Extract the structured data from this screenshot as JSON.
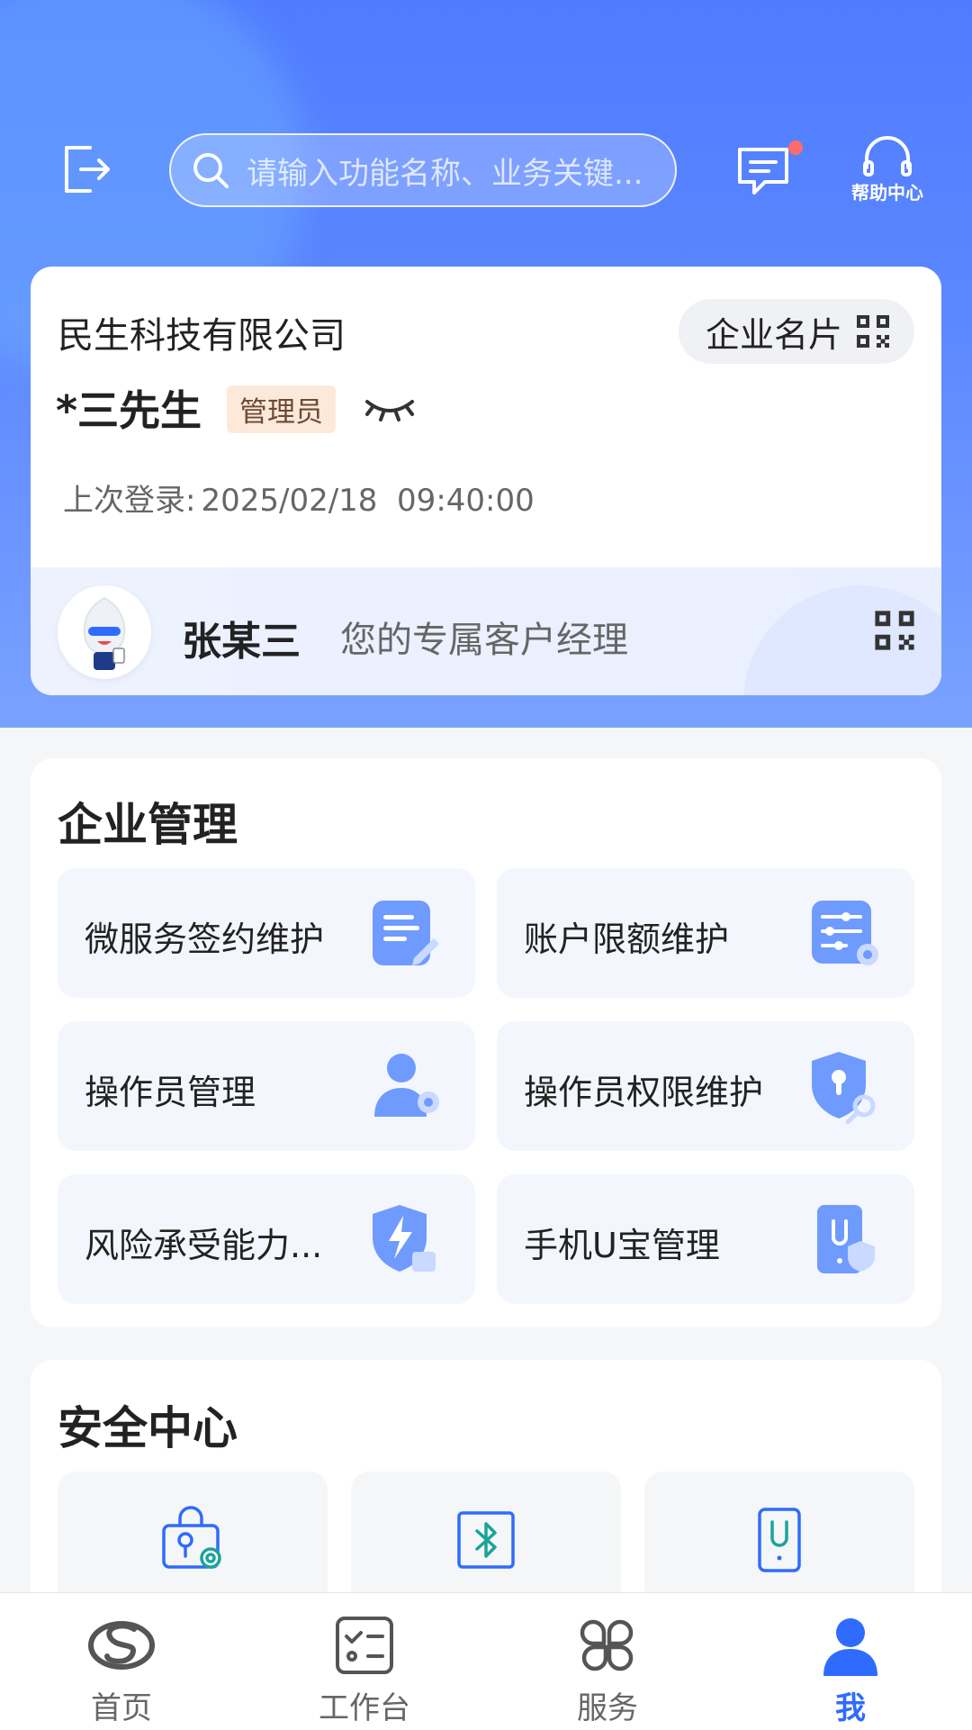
{
  "header": {
    "search_placeholder": "请输入功能名称、业务关键...",
    "help_label": "帮助中心",
    "icons": [
      "logout-icon",
      "search-icon",
      "message-icon",
      "headset-icon"
    ]
  },
  "profile": {
    "company": "民生科技有限公司",
    "card_button": "企业名片",
    "user_name": "*三先生",
    "role": "管理员",
    "last_login_label": "上次登录:",
    "last_login_value": "2025/02/18  09:40:00",
    "manager_name": "张某三",
    "manager_desc": "您的专属客户经理"
  },
  "enterprise": {
    "title": "企业管理",
    "tiles": [
      {
        "label": "微服务签约维护",
        "icon": "document-edit-icon"
      },
      {
        "label": "账户限额维护",
        "icon": "sliders-settings-icon"
      },
      {
        "label": "操作员管理",
        "icon": "user-settings-icon"
      },
      {
        "label": "操作员权限维护",
        "icon": "shield-key-icon"
      },
      {
        "label": "风险承受能力...",
        "icon": "shield-lightning-icon"
      },
      {
        "label": "手机U宝管理",
        "icon": "phone-ukey-icon"
      }
    ]
  },
  "security": {
    "title": "安全中心",
    "icons": [
      "lock-location-settings-icon",
      "bluetooth-icon",
      "phone-u-icon"
    ]
  },
  "nav": {
    "items": [
      {
        "label": "首页",
        "icon": "home-logo-icon"
      },
      {
        "label": "工作台",
        "icon": "checklist-icon"
      },
      {
        "label": "服务",
        "icon": "services-grid-icon"
      },
      {
        "label": "我",
        "icon": "person-icon"
      }
    ],
    "active_index": 3
  },
  "colors": {
    "primary": "#2f6bff",
    "header_gradient_top": "#4f7cff",
    "header_gradient_bottom": "#79a2ff",
    "badge_bg": "#fde9da",
    "notification_dot": "#ff6b6b",
    "security_icon_teal": "#1aa49a",
    "security_icon_blue": "#2f6bff"
  }
}
